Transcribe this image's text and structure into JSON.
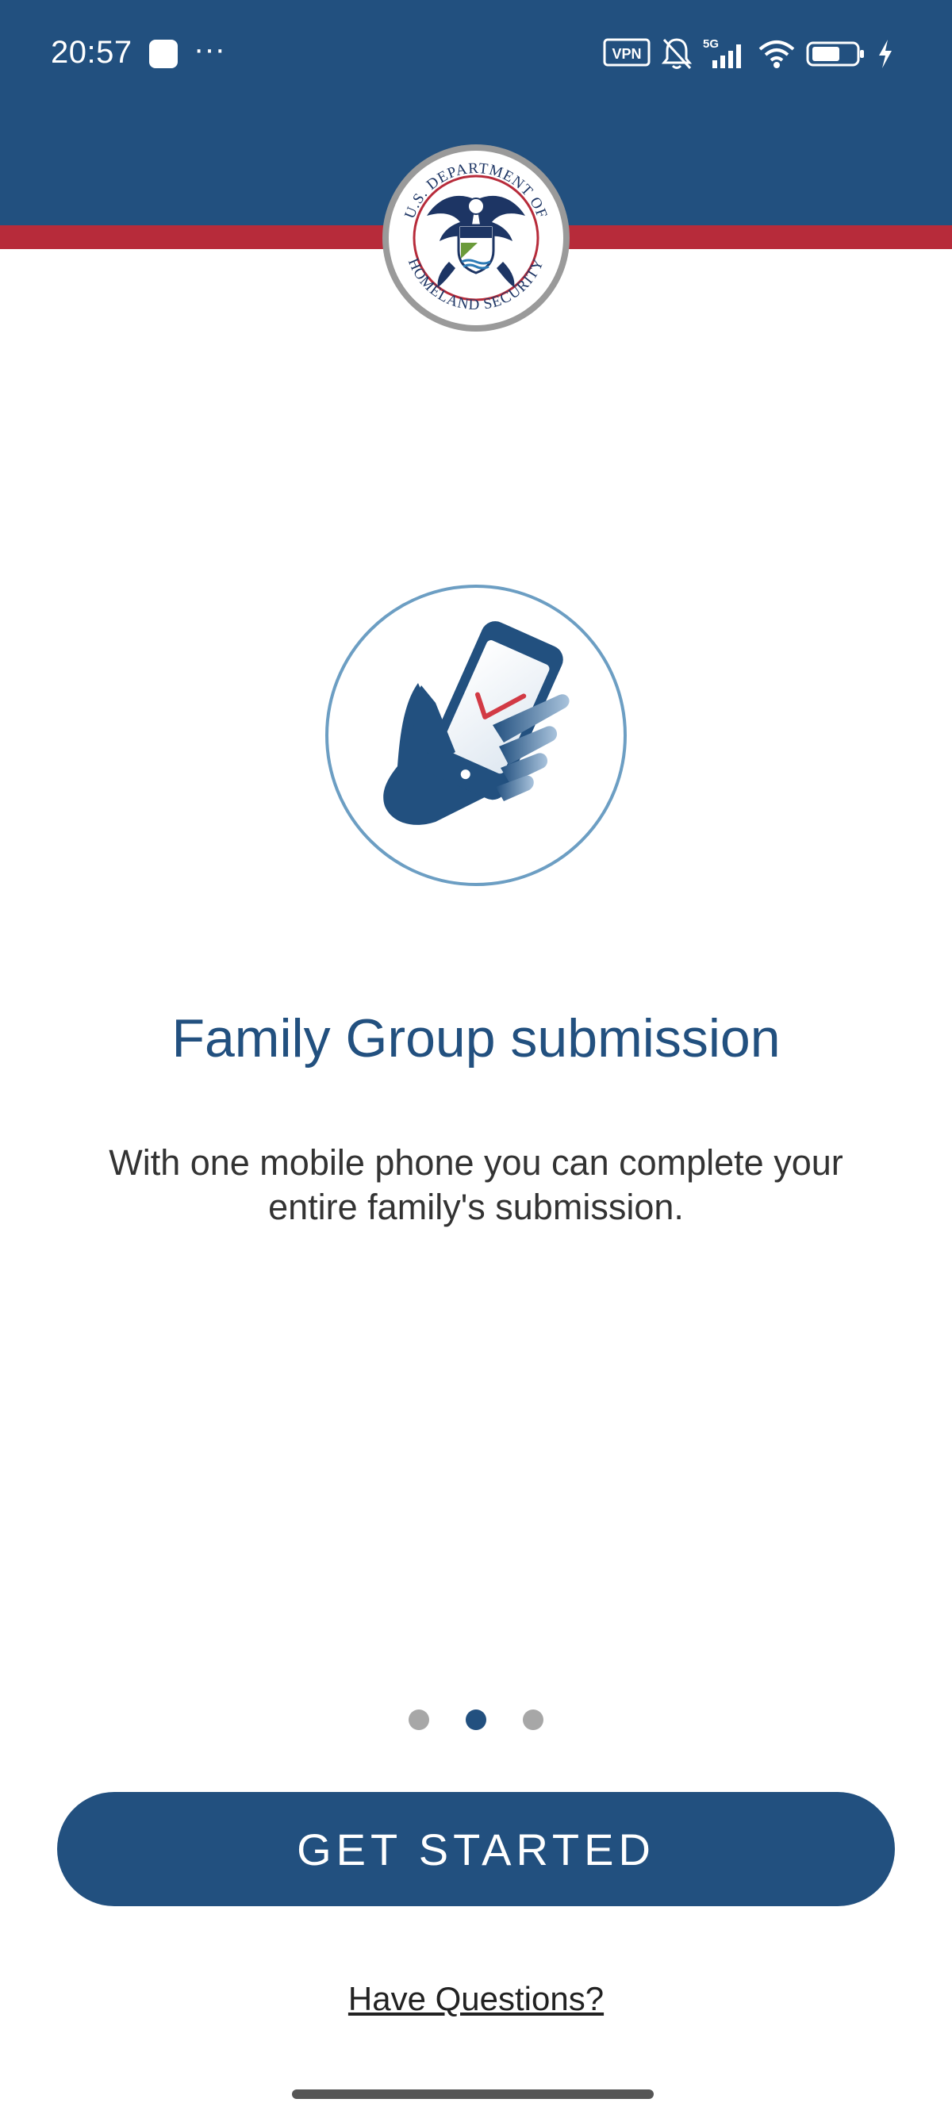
{
  "status_bar": {
    "time": "20:57",
    "more": "···",
    "vpn_label": "VPN",
    "network_label": "5G",
    "icons": [
      "app-icon",
      "vpn-icon",
      "bell-muted-icon",
      "signal-icon",
      "wifi-icon",
      "battery-icon",
      "charging-icon"
    ]
  },
  "header": {
    "seal_text_top": "U.S. DEPARTMENT OF",
    "seal_text_bottom": "HOMELAND SECURITY"
  },
  "onboarding": {
    "illustration": "phone-in-hand-checkmark-icon",
    "title": "Family Group submission",
    "description": "With one mobile phone you can complete your entire family's submission.",
    "page_count": 3,
    "current_page": 2
  },
  "actions": {
    "get_started_label": "GET STARTED",
    "questions_label": "Have Questions?"
  },
  "colors": {
    "brand_blue": "#22507f",
    "brand_red": "#b72b3a",
    "text_dark": "#333333",
    "dot_inactive": "#a7a7a7"
  }
}
